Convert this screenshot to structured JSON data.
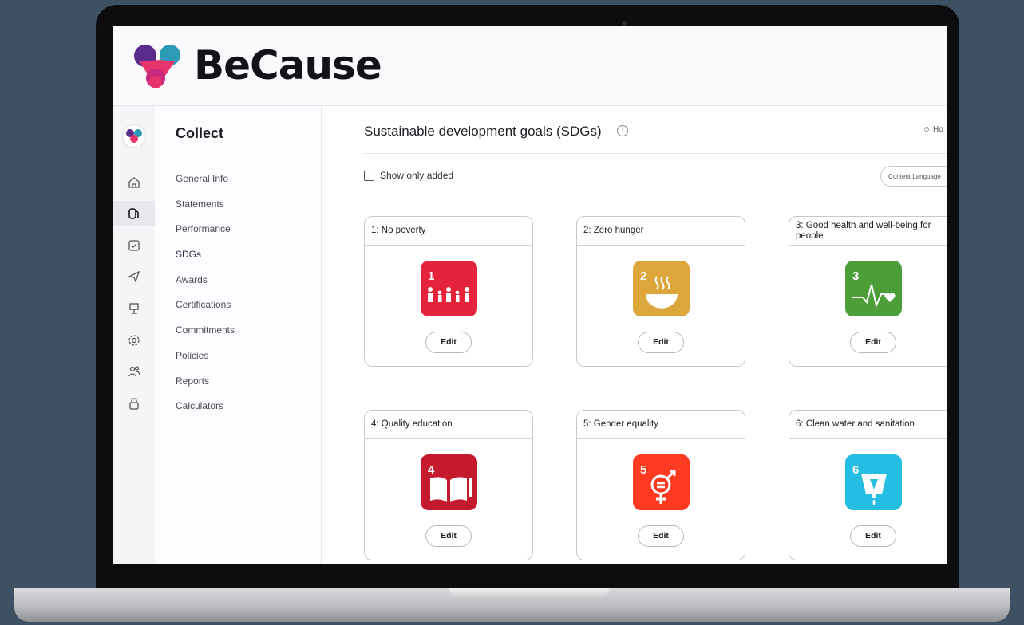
{
  "brand": {
    "name": "BeCause"
  },
  "sidebar": {
    "title": "Collect",
    "items": [
      {
        "label": "General Info"
      },
      {
        "label": "Statements"
      },
      {
        "label": "Performance"
      },
      {
        "label": "SDGs",
        "active": true
      },
      {
        "label": "Awards"
      },
      {
        "label": "Certifications"
      },
      {
        "label": "Commitments"
      },
      {
        "label": "Policies"
      },
      {
        "label": "Reports"
      },
      {
        "label": "Calculators"
      }
    ]
  },
  "rail": {
    "icons": [
      "home-icon",
      "collect-icon",
      "checkbox-icon",
      "send-icon",
      "presentation-icon",
      "gear-icon",
      "users-icon",
      "lock-icon"
    ],
    "active": "collect-icon"
  },
  "main": {
    "title": "Sustainable development goals (SDGs)",
    "help_label": "Ho",
    "show_only_added": "Show only added",
    "content_language": "Content Language"
  },
  "cards": [
    {
      "title": "1: No poverty",
      "number": "1",
      "color": "#e5243b",
      "edit": "Edit"
    },
    {
      "title": "2: Zero hunger",
      "number": "2",
      "color": "#dda63a",
      "edit": "Edit"
    },
    {
      "title": "3: Good health and well-being for people",
      "number": "3",
      "color": "#4c9f38",
      "edit": "Edit"
    },
    {
      "title": "4: Quality education",
      "number": "4",
      "color": "#c5192d",
      "edit": "Edit"
    },
    {
      "title": "5: Gender equality",
      "number": "5",
      "color": "#ff3a21",
      "edit": "Edit"
    },
    {
      "title": "6: Clean water and sanitation",
      "number": "6",
      "color": "#26bde2",
      "edit": "Edit"
    }
  ],
  "colors": {
    "background": "#3e5163",
    "brand_purple": "#5b2b8c",
    "brand_pink": "#e8336d"
  }
}
